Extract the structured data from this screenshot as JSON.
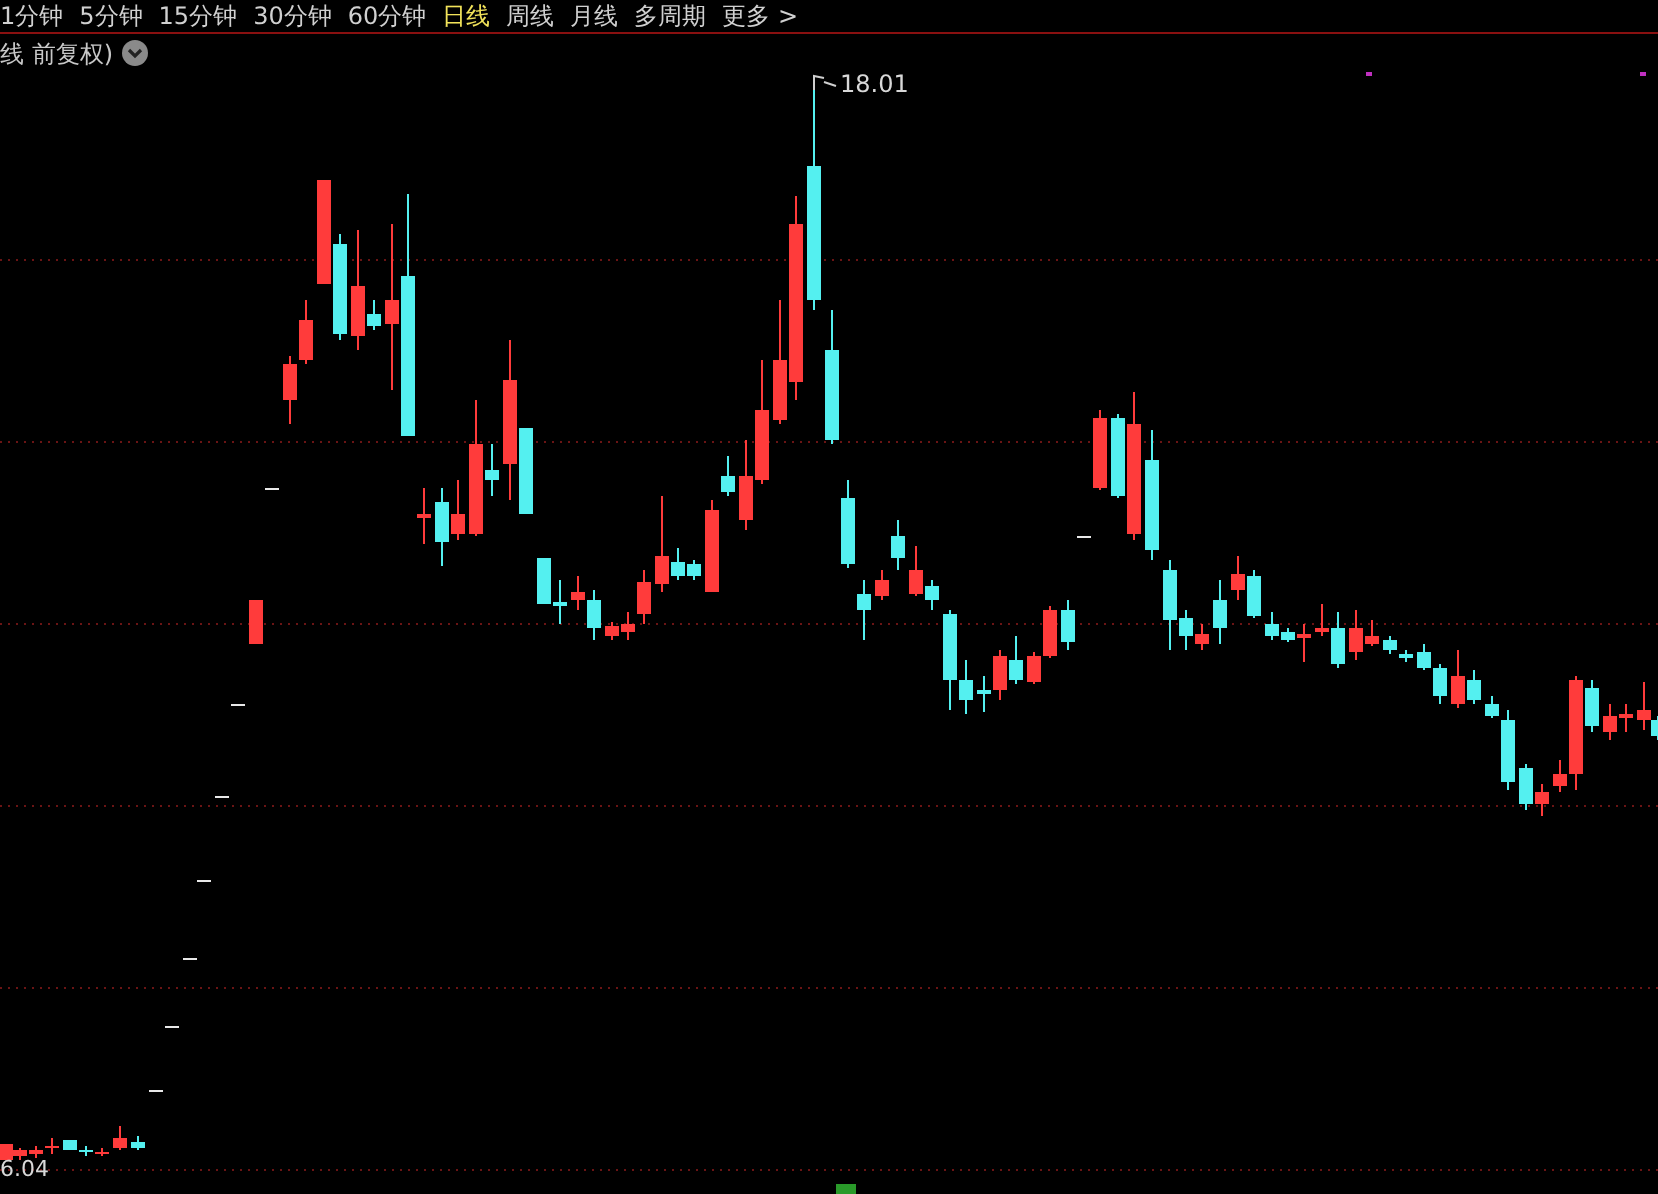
{
  "period_tabs": [
    {
      "label": "1分钟",
      "selected": false
    },
    {
      "label": "5分钟",
      "selected": false
    },
    {
      "label": "15分钟",
      "selected": false
    },
    {
      "label": "30分钟",
      "selected": false
    },
    {
      "label": "60分钟",
      "selected": false
    },
    {
      "label": "日线",
      "selected": true
    },
    {
      "label": "周线",
      "selected": false
    },
    {
      "label": "月线",
      "selected": false
    },
    {
      "label": "多周期",
      "selected": false
    },
    {
      "label": "更多 >",
      "selected": false
    }
  ],
  "chart": {
    "title": "线 前复权)",
    "high_label": "18.01",
    "low_label": "6.04"
  }
}
